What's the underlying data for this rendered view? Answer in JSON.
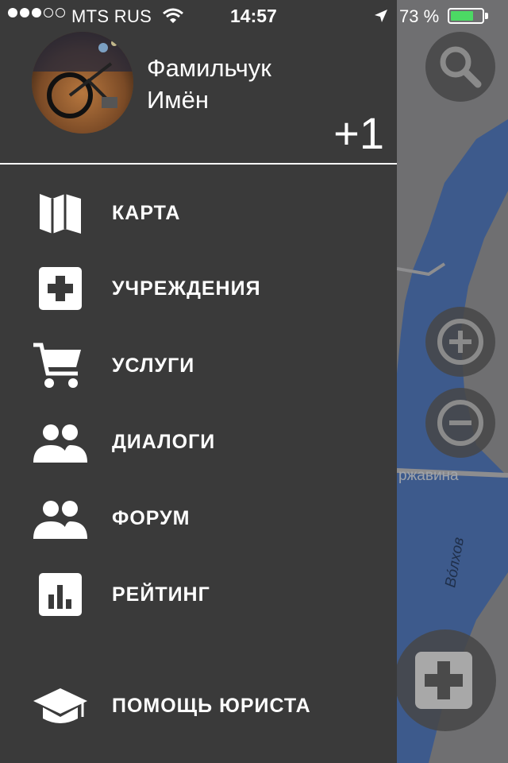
{
  "status_bar": {
    "carrier": "MTS RUS",
    "time": "14:57",
    "battery_percent": "73 %",
    "battery_level": 0.73,
    "signal_bars_filled": 3,
    "signal_bars_total": 5
  },
  "profile": {
    "first_line": "Фамильчук",
    "second_line": "Имён",
    "karma": "+1"
  },
  "menu": [
    {
      "label": "КАРТА",
      "icon": "map-icon"
    },
    {
      "label": "УЧРЕЖДЕНИЯ",
      "icon": "medical-cross-icon"
    },
    {
      "label": "УСЛУГИ",
      "icon": "cart-icon"
    },
    {
      "label": "ДИАЛОГИ",
      "icon": "people-icon"
    },
    {
      "label": "ФОРУМ",
      "icon": "people-icon"
    },
    {
      "label": "РЕЙТИНГ",
      "icon": "bar-chart-icon"
    },
    {
      "label": "ПОМОЩЬ ЮРИСТА",
      "icon": "graduation-cap-icon"
    }
  ],
  "map": {
    "street_label": "ржавина",
    "river_label": "Во́лхов"
  },
  "colors": {
    "drawer": "#3a3a3a",
    "river": "#3d5a8c",
    "battery": "#4cd964"
  }
}
